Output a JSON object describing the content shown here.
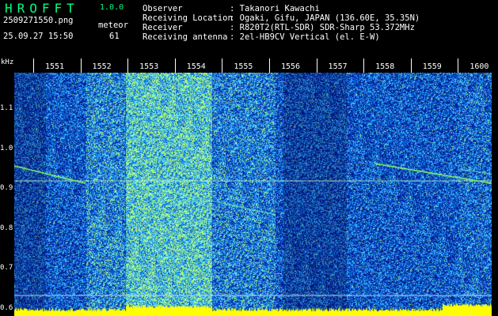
{
  "header": {
    "app_name": "HROFFT",
    "version": "1.0.0",
    "filename": "2509271550.png",
    "datetime": "25.09.27 15:50",
    "mode": "meteor",
    "count": "61",
    "observer_label": "Observer",
    "observer_value": ": Takanori Kawachi",
    "location_label": "Receiving Location",
    "location_value": ": Ogaki, Gifu, JAPAN (136.60E, 35.35N)",
    "receiver_label": "Receiver",
    "receiver_value": ": R820T2(RTL-SDR) SDR-Sharp 53.372MHz",
    "antenna_label": "Receiving antenna",
    "antenna_value": ": 2el-HB9CV Vertical (el. E-W)"
  },
  "time_axis": {
    "labels": [
      "1551",
      "1552",
      "1553",
      "1554",
      "1555",
      "1556",
      "1557",
      "1558",
      "1559",
      "1600"
    ]
  },
  "freq_axis": {
    "unit": "kHz",
    "labels": [
      "1.1",
      "1.0",
      "0.9",
      "0.8",
      "0.7",
      "0.6"
    ],
    "values": [
      1.1,
      1.0,
      0.9,
      0.8,
      0.7,
      0.6
    ],
    "range_khz": [
      0.58,
      1.19
    ]
  },
  "colors": {
    "background": "#0a1a8c",
    "noise_low": "#1030c0",
    "noise_high": "#2eb0ff",
    "signal": "#d0ff50",
    "baseline_bar": "#ffff00",
    "header_title": "#00ff7f",
    "text": "#ffffff"
  }
}
